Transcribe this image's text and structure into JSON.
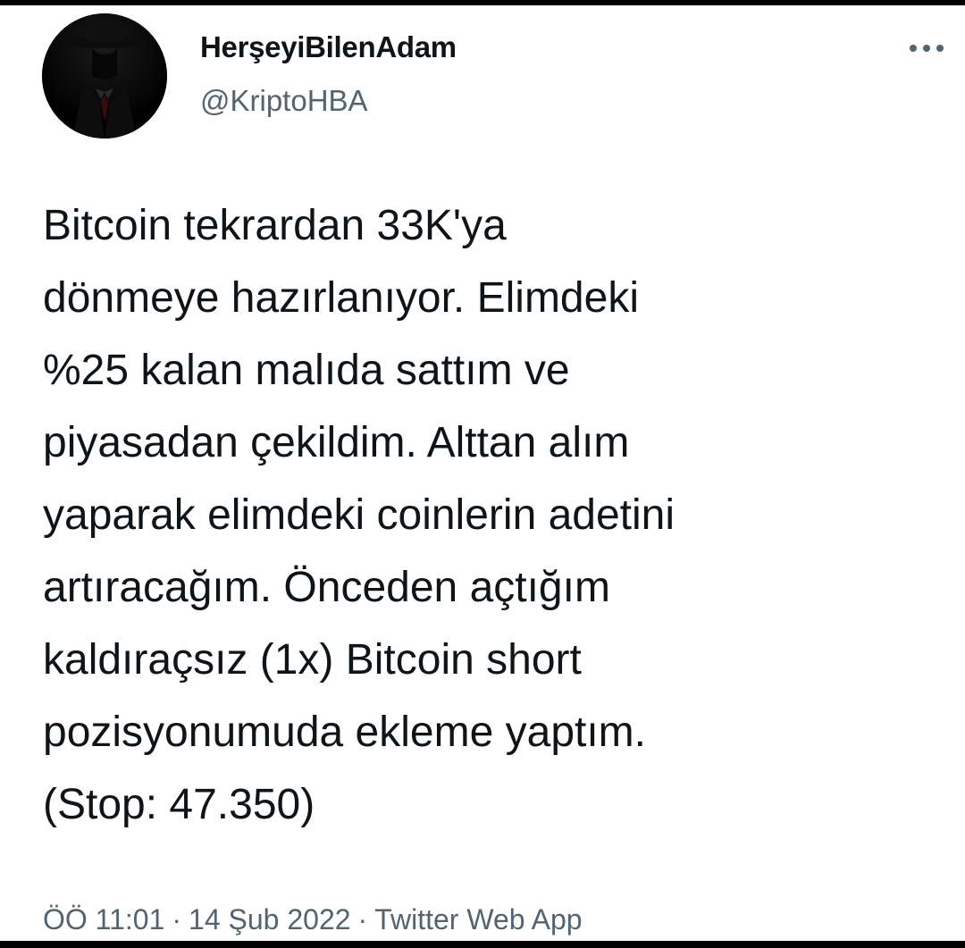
{
  "tweet": {
    "author": {
      "display_name": "HerşeyiBilenAdam",
      "handle": "@KriptoHBA",
      "avatar_icon": "hat-silhouette-avatar"
    },
    "more_icon": "more-horizontal-icon",
    "text_lines": [
      "Bitcoin tekrardan 33K'ya",
      "dönmeye hazırlanıyor. Elimdeki",
      "%25 kalan malıda sattım ve",
      "piyasadan çekildim. Alttan alım",
      "yaparak elimdeki coinlerin adetini",
      "artıracağım. Önceden açtığım",
      "kaldıraçsız (1x) Bitcoin short",
      "pozisyonumuda ekleme yaptım.",
      "(Stop: 47.350)"
    ],
    "meta": {
      "time": "ÖÖ 11:01",
      "separator": "·",
      "date": "14 Şub 2022",
      "source": "Twitter Web App"
    }
  },
  "colors": {
    "background": "#ffffff",
    "frame": "#000000",
    "primary_text": "#0f1419",
    "secondary_text": "#536471"
  }
}
